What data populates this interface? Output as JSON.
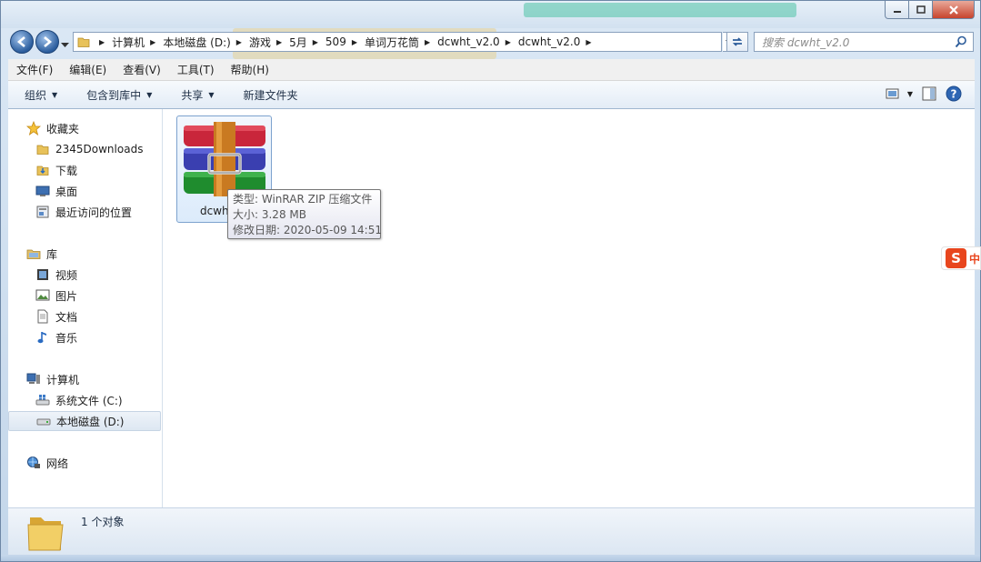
{
  "window": {
    "controls": {
      "minimize": "—",
      "maximize": "□",
      "close": "✕"
    }
  },
  "address": {
    "crumbs": [
      "计算机",
      "本地磁盘 (D:)",
      "游戏",
      "5月",
      "509",
      "单词万花筒",
      "dcwht_v2.0",
      "dcwht_v2.0"
    ],
    "search_placeholder": "搜索 dcwht_v2.0"
  },
  "menu": {
    "items": [
      "文件(F)",
      "编辑(E)",
      "查看(V)",
      "工具(T)",
      "帮助(H)"
    ]
  },
  "toolbar": {
    "organize": "组织",
    "include_in_library": "包含到库中",
    "share": "共享",
    "new_folder": "新建文件夹"
  },
  "sidebar": {
    "favorites": {
      "label": "收藏夹",
      "items": [
        "2345Downloads",
        "下载",
        "桌面",
        "最近访问的位置"
      ]
    },
    "libraries": {
      "label": "库",
      "items": [
        "视频",
        "图片",
        "文档",
        "音乐"
      ]
    },
    "computer": {
      "label": "计算机",
      "items": [
        "系统文件 (C:)",
        "本地磁盘 (D:)"
      ]
    },
    "network": {
      "label": "网络"
    }
  },
  "content": {
    "file": {
      "name": "dcwht"
    },
    "tooltip": {
      "type": "类型: WinRAR ZIP 压缩文件",
      "size": "大小: 3.28 MB",
      "modified": "修改日期: 2020-05-09 14:51"
    }
  },
  "status": {
    "text": "1 个对象"
  },
  "ime": {
    "logo": "S",
    "lang": "中"
  }
}
